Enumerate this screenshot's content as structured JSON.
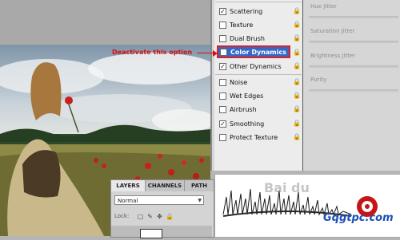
{
  "annotation": {
    "text": "Deactivate this option",
    "color": "#d01010"
  },
  "brush_options": [
    {
      "label": "Scattering",
      "checked": true
    },
    {
      "label": "Texture",
      "checked": false
    },
    {
      "label": "Dual Brush",
      "checked": false
    },
    {
      "label": "Color Dynamics",
      "checked": true,
      "selected": true
    },
    {
      "label": "Other Dynamics",
      "checked": true
    },
    {
      "label": "Noise",
      "checked": false
    },
    {
      "label": "Wet Edges",
      "checked": false
    },
    {
      "label": "Airbrush",
      "checked": false
    },
    {
      "label": "Smoothing",
      "checked": true
    },
    {
      "label": "Protect Texture",
      "checked": false
    }
  ],
  "jitter_labels": [
    "Hue Jitter",
    "Saturation Jitter",
    "Brightness Jitter",
    "Purity"
  ],
  "layers_panel": {
    "tabs": [
      "LAYERS",
      "CHANNELS",
      "PATH"
    ],
    "blend_mode": "Normal",
    "lock_label": "Lock:"
  },
  "watermark": {
    "baidu": "Bai du",
    "site": "Gqgtpc.com"
  },
  "colors": {
    "accent": "#3468c8",
    "highlight_border": "#e02020"
  }
}
